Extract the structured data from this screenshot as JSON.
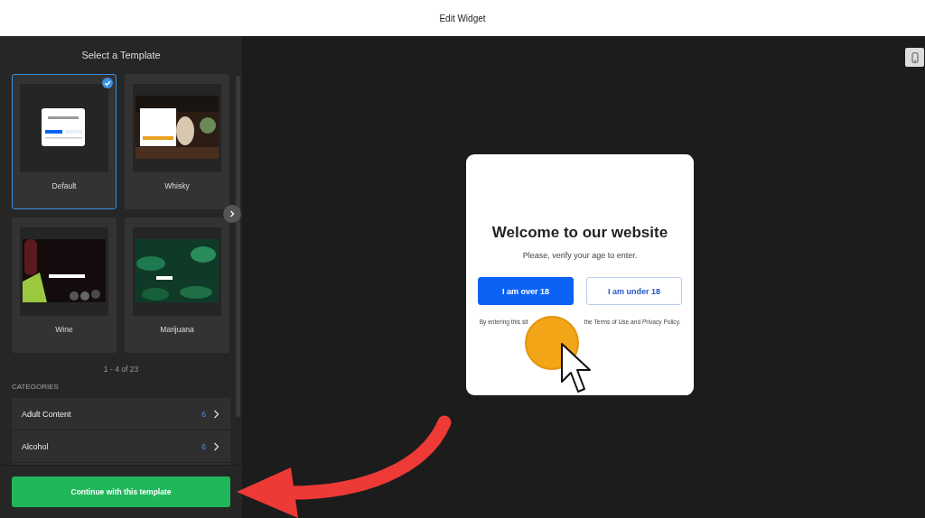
{
  "header": {
    "title": "Edit Widget"
  },
  "sidebar": {
    "title": "Select a Template",
    "templates": [
      {
        "name": "Default",
        "selected": true
      },
      {
        "name": "Whisky",
        "selected": false
      },
      {
        "name": "Wine",
        "selected": false
      },
      {
        "name": "Marijuana",
        "selected": false
      }
    ],
    "pagination": "1 - 4 of 23",
    "categories_heading": "CATEGORIES",
    "categories": [
      {
        "label": "Adult Content",
        "count": "6"
      },
      {
        "label": "Alcohol",
        "count": "6"
      }
    ],
    "continue_button": "Continue with this template"
  },
  "preview": {
    "heading": "Welcome to our website",
    "subtitle": "Please, verify your age to enter.",
    "buttons": [
      {
        "label": "I am over 18",
        "kind": "primary"
      },
      {
        "label": "I am under 18",
        "kind": "secondary"
      }
    ],
    "disclaimer": [
      "By entering this sit",
      "the Terms of Use and Privacy Policy."
    ]
  }
}
